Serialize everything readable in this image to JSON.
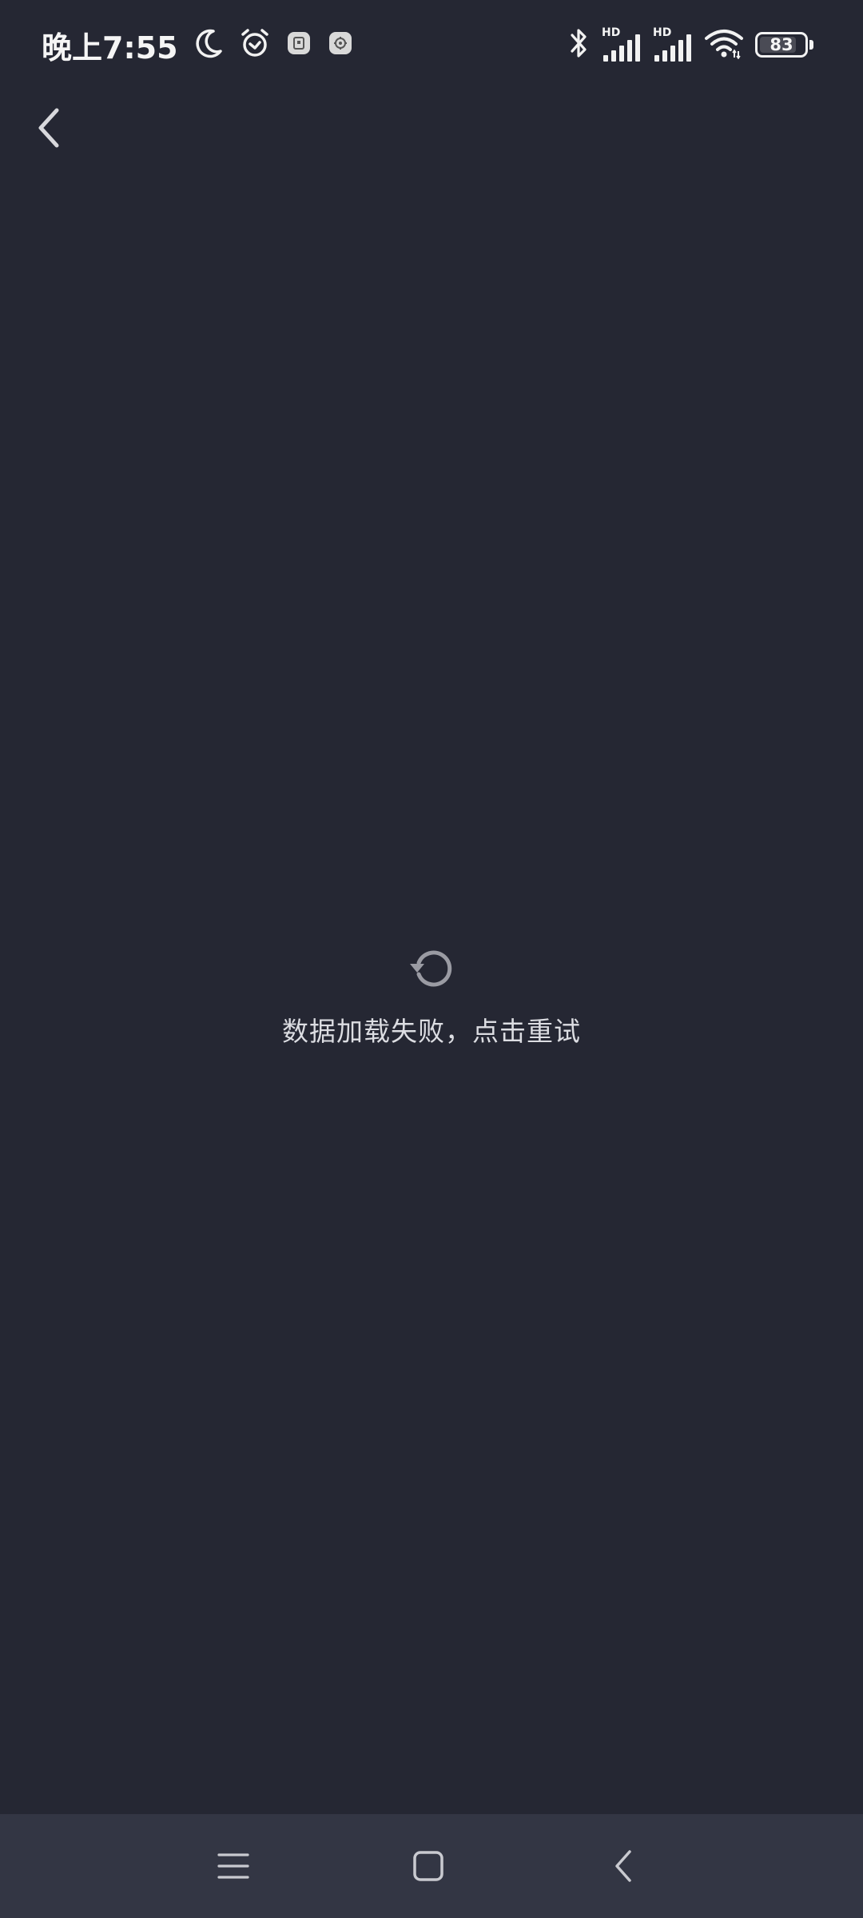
{
  "status_bar": {
    "time": "晚上7:55",
    "left_icons": [
      "moon-icon",
      "alarm-icon",
      "app-notification-icon-1",
      "app-notification-icon-2"
    ],
    "right_icons": [
      "bluetooth-icon",
      "signal-hd-icon",
      "signal-hd-icon",
      "wifi-icon",
      "battery-icon"
    ],
    "hd_label_1": "HD",
    "hd_label_2": "HD",
    "battery_level": "83",
    "battery_fraction": 0.83
  },
  "header": {
    "back_icon": "chevron-left-icon"
  },
  "main": {
    "retry_icon": "refresh-icon",
    "error_message": "数据加载失败，点击重试"
  },
  "nav_bar": {
    "menu_icon": "menu-icon",
    "home_icon": "home-icon",
    "back_icon": "back-icon"
  },
  "colors": {
    "background": "#252733",
    "nav_background": "#333644",
    "icon_gray": "#9a9ba3",
    "text": "#dcdde2"
  }
}
